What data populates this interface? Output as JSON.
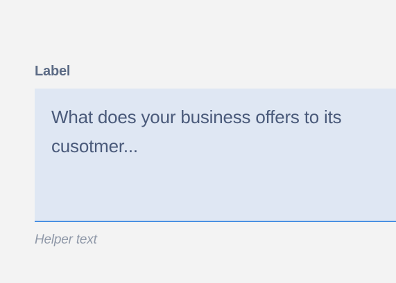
{
  "field": {
    "label": "Label",
    "placeholder": "What does your business offers to its cusotmer...",
    "value": "",
    "helper_text": "Helper text"
  },
  "colors": {
    "background": "#f3f3f3",
    "label": "#5c6b85",
    "input_background": "#dfe7f3",
    "input_text": "#4a5a7a",
    "focus_border": "#4a90e2",
    "helper_text": "#8f98a8"
  }
}
